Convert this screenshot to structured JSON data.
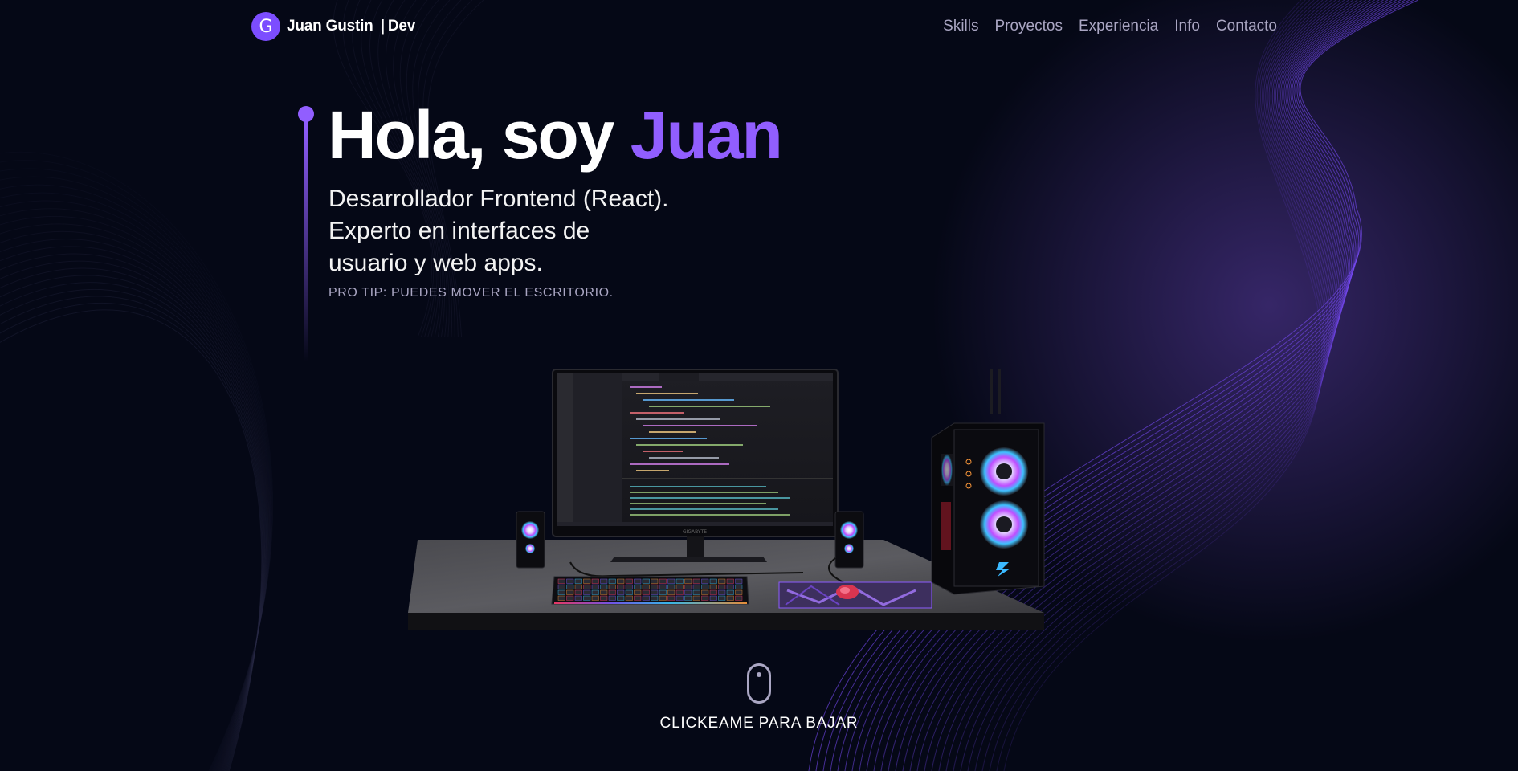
{
  "navbar": {
    "logo_letter": "G",
    "brand_name": "Juan Gustin",
    "brand_separator": "|",
    "brand_role": "Dev",
    "links": [
      {
        "label": "Skills"
      },
      {
        "label": "Proyectos"
      },
      {
        "label": "Experiencia"
      },
      {
        "label": "Info"
      },
      {
        "label": "Contacto"
      }
    ]
  },
  "hero": {
    "title_prefix": "Hola, soy ",
    "title_name": "Juan",
    "subtitle_lines": [
      "Desarrollador Frontend (React).",
      "Experto en interfaces de",
      "usuario y web apps."
    ],
    "tip": "PRO TIP: PUEDES MOVER EL ESCRITORIO."
  },
  "monitor": {
    "brand": "GIGABYTE"
  },
  "scroll": {
    "label": "CLICKEAME PARA BAJAR"
  },
  "colors": {
    "background": "#050816",
    "accent": "#915eff",
    "secondary_text": "#aaa6c3"
  },
  "icons": {
    "logo": "letter-g-circle-logo",
    "scroll": "mouse-scroll-icon"
  }
}
